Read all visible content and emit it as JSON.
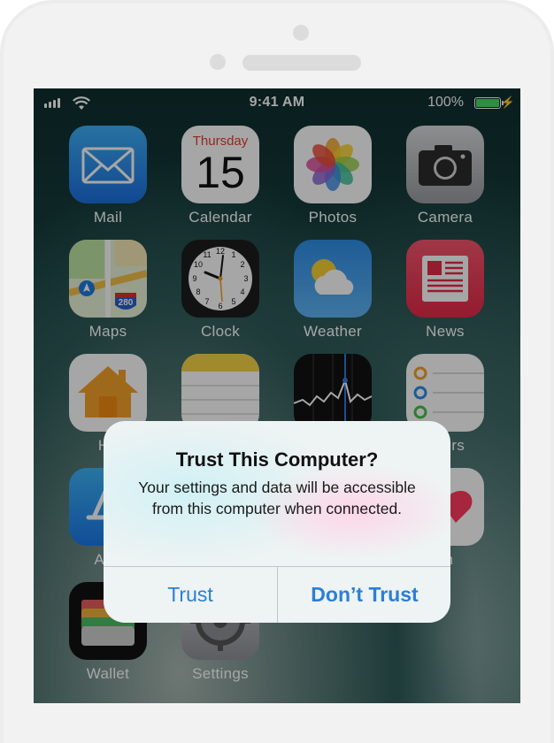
{
  "status_bar": {
    "time": "9:41 AM",
    "battery": "100%",
    "battery_level": 1.0,
    "charging_icon": "lightning-icon"
  },
  "apps": [
    {
      "name": "mail-app",
      "label": "Mail",
      "icon": "envelope-icon"
    },
    {
      "name": "calendar-app",
      "label": "Calendar",
      "icon": "calendar-icon",
      "weekday": "Thursday",
      "day": "15"
    },
    {
      "name": "photos-app",
      "label": "Photos",
      "icon": "flower-icon"
    },
    {
      "name": "camera-app",
      "label": "Camera",
      "icon": "camera-icon"
    },
    {
      "name": "maps-app",
      "label": "Maps",
      "icon": "map-icon",
      "shield": "280"
    },
    {
      "name": "clock-app",
      "label": "Clock",
      "icon": "clock-icon"
    },
    {
      "name": "weather-app",
      "label": "Weather",
      "icon": "sun-cloud-icon"
    },
    {
      "name": "news-app",
      "label": "News",
      "icon": "news-icon"
    },
    {
      "name": "home-app",
      "label": "Ho",
      "icon": "house-icon"
    },
    {
      "name": "notes-app",
      "label": "",
      "icon": "notes-icon"
    },
    {
      "name": "stocks-app",
      "label": "",
      "icon": "stocks-icon"
    },
    {
      "name": "reminders-app",
      "label": "nders",
      "icon": "reminders-icon"
    },
    {
      "name": "appstore-app",
      "label": "App",
      "icon": "appstore-icon"
    },
    {
      "name": "health-app",
      "label": "lth",
      "icon": "heart-icon"
    },
    {
      "name": "wallet-app",
      "label": "Wallet",
      "icon": "wallet-icon"
    },
    {
      "name": "settings-app",
      "label": "Settings",
      "icon": "gear-icon"
    }
  ],
  "dialog": {
    "title": "Trust This Computer?",
    "message": "Your settings and data will be accessible from this computer when connected.",
    "trust_label": "Trust",
    "dont_trust_label": "Don’t Trust"
  },
  "colors": {
    "accent": "#2a7fd6",
    "battery": "#4cd964"
  }
}
